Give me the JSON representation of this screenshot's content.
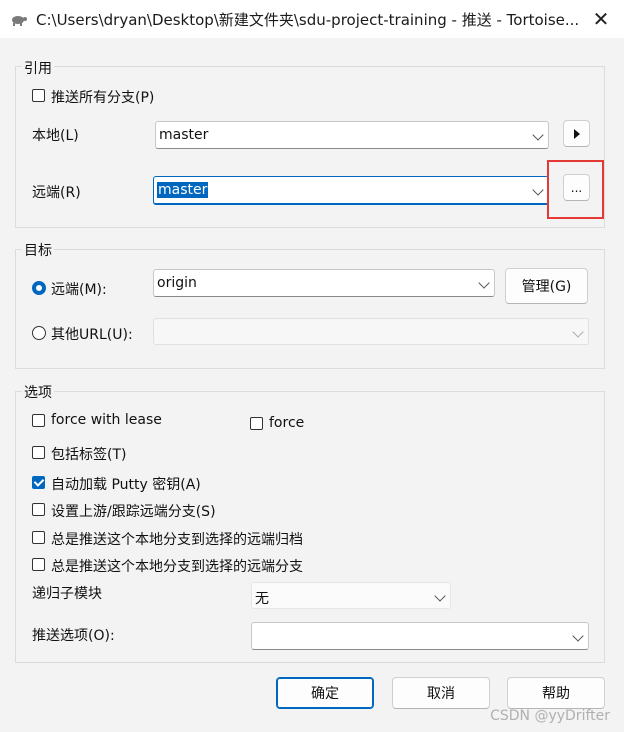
{
  "window": {
    "title": "C:\\Users\\dryan\\Desktop\\新建文件夹\\sdu-project-training - 推送 - Tortoise..."
  },
  "refs": {
    "legend": "引用",
    "push_all_label": "推送所有分支(P)",
    "push_all_checked": false,
    "local_label": "本地(L)",
    "local_value": "master",
    "remote_label": "远端(R)",
    "remote_value": "master",
    "remote_more_label": "..."
  },
  "destination": {
    "legend": "目标",
    "remote_label": "远端(M):",
    "remote_selected": true,
    "remote_value": "origin",
    "manage_label": "管理(G)",
    "other_url_label": "其他URL(U):",
    "other_url_selected": false,
    "other_url_value": ""
  },
  "options": {
    "legend": "选项",
    "force_with_lease_label": "force with lease",
    "force_with_lease_checked": false,
    "force_label": "force",
    "force_checked": false,
    "include_tags_label": "包括标签(T)",
    "include_tags_checked": false,
    "autoload_putty_label": "自动加载 Putty 密钥(A)",
    "autoload_putty_checked": true,
    "set_upstream_label": "设置上游/跟踪远端分支(S)",
    "set_upstream_checked": false,
    "always_archive_label": "总是推送这个本地分支到选择的远端归档",
    "always_archive_checked": false,
    "always_branch_label": "总是推送这个本地分支到选择的远端分支",
    "always_branch_checked": false,
    "recurse_label": "递归子模块",
    "recurse_value": "无",
    "push_options_label": "推送选项(O):",
    "push_options_value": ""
  },
  "buttons": {
    "ok": "确定",
    "cancel": "取消",
    "help": "帮助"
  },
  "watermark": "CSDN @yyDrifter",
  "colors": {
    "accent": "#0067c0",
    "highlight": "#e53935"
  }
}
